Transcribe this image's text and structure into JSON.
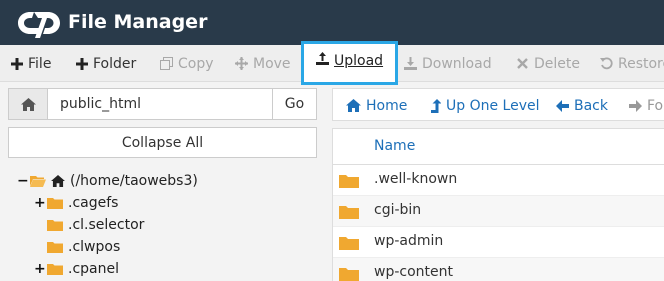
{
  "app": {
    "title": "File Manager"
  },
  "toolbar": {
    "file": "File",
    "folder": "Folder",
    "copy": "Copy",
    "move": "Move",
    "upload": "Upload",
    "download": "Download",
    "delete": "Delete",
    "restore": "Restore"
  },
  "path_bar": {
    "value": "public_html",
    "go": "Go"
  },
  "collapse_all": "Collapse All",
  "tree": {
    "root": "(/home/taowebs3)",
    "items": [
      ".cagefs",
      ".cl.selector",
      ".clwpos",
      ".cpanel"
    ]
  },
  "nav": {
    "home": "Home",
    "up": "Up One Level",
    "back": "Back",
    "forward": "For"
  },
  "files": {
    "column_name": "Name",
    "rows": [
      ".well-known",
      "cgi-bin",
      "wp-admin",
      "wp-content"
    ]
  },
  "colors": {
    "header_bg": "#293a4a",
    "accent": "#2aa7e6",
    "link": "#1d6fb8",
    "folder": "#f0a830"
  },
  "icons": {
    "logo": "cpanel-logo",
    "folder": "folder-icon",
    "home": "home-icon"
  }
}
